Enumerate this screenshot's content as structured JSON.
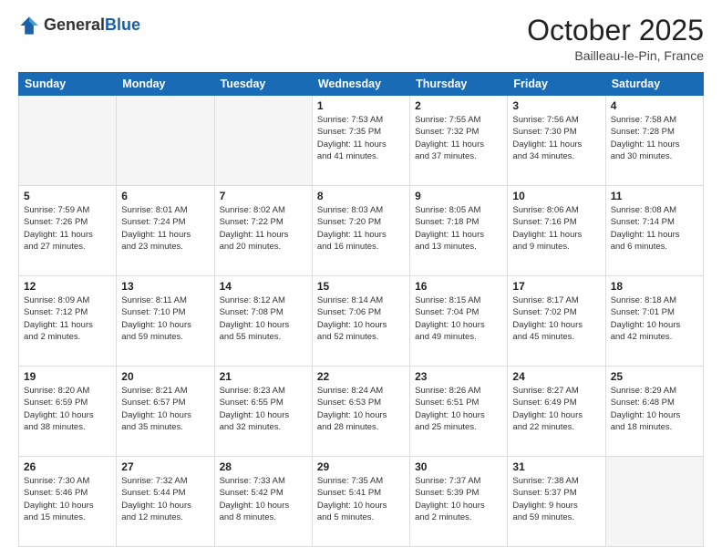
{
  "header": {
    "logo_general": "General",
    "logo_blue": "Blue",
    "month_title": "October 2025",
    "location": "Bailleau-le-Pin, France"
  },
  "days_of_week": [
    "Sunday",
    "Monday",
    "Tuesday",
    "Wednesday",
    "Thursday",
    "Friday",
    "Saturday"
  ],
  "weeks": [
    [
      {
        "day": "",
        "info": ""
      },
      {
        "day": "",
        "info": ""
      },
      {
        "day": "",
        "info": ""
      },
      {
        "day": "1",
        "info": "Sunrise: 7:53 AM\nSunset: 7:35 PM\nDaylight: 11 hours\nand 41 minutes."
      },
      {
        "day": "2",
        "info": "Sunrise: 7:55 AM\nSunset: 7:32 PM\nDaylight: 11 hours\nand 37 minutes."
      },
      {
        "day": "3",
        "info": "Sunrise: 7:56 AM\nSunset: 7:30 PM\nDaylight: 11 hours\nand 34 minutes."
      },
      {
        "day": "4",
        "info": "Sunrise: 7:58 AM\nSunset: 7:28 PM\nDaylight: 11 hours\nand 30 minutes."
      }
    ],
    [
      {
        "day": "5",
        "info": "Sunrise: 7:59 AM\nSunset: 7:26 PM\nDaylight: 11 hours\nand 27 minutes."
      },
      {
        "day": "6",
        "info": "Sunrise: 8:01 AM\nSunset: 7:24 PM\nDaylight: 11 hours\nand 23 minutes."
      },
      {
        "day": "7",
        "info": "Sunrise: 8:02 AM\nSunset: 7:22 PM\nDaylight: 11 hours\nand 20 minutes."
      },
      {
        "day": "8",
        "info": "Sunrise: 8:03 AM\nSunset: 7:20 PM\nDaylight: 11 hours\nand 16 minutes."
      },
      {
        "day": "9",
        "info": "Sunrise: 8:05 AM\nSunset: 7:18 PM\nDaylight: 11 hours\nand 13 minutes."
      },
      {
        "day": "10",
        "info": "Sunrise: 8:06 AM\nSunset: 7:16 PM\nDaylight: 11 hours\nand 9 minutes."
      },
      {
        "day": "11",
        "info": "Sunrise: 8:08 AM\nSunset: 7:14 PM\nDaylight: 11 hours\nand 6 minutes."
      }
    ],
    [
      {
        "day": "12",
        "info": "Sunrise: 8:09 AM\nSunset: 7:12 PM\nDaylight: 11 hours\nand 2 minutes."
      },
      {
        "day": "13",
        "info": "Sunrise: 8:11 AM\nSunset: 7:10 PM\nDaylight: 10 hours\nand 59 minutes."
      },
      {
        "day": "14",
        "info": "Sunrise: 8:12 AM\nSunset: 7:08 PM\nDaylight: 10 hours\nand 55 minutes."
      },
      {
        "day": "15",
        "info": "Sunrise: 8:14 AM\nSunset: 7:06 PM\nDaylight: 10 hours\nand 52 minutes."
      },
      {
        "day": "16",
        "info": "Sunrise: 8:15 AM\nSunset: 7:04 PM\nDaylight: 10 hours\nand 49 minutes."
      },
      {
        "day": "17",
        "info": "Sunrise: 8:17 AM\nSunset: 7:02 PM\nDaylight: 10 hours\nand 45 minutes."
      },
      {
        "day": "18",
        "info": "Sunrise: 8:18 AM\nSunset: 7:01 PM\nDaylight: 10 hours\nand 42 minutes."
      }
    ],
    [
      {
        "day": "19",
        "info": "Sunrise: 8:20 AM\nSunset: 6:59 PM\nDaylight: 10 hours\nand 38 minutes."
      },
      {
        "day": "20",
        "info": "Sunrise: 8:21 AM\nSunset: 6:57 PM\nDaylight: 10 hours\nand 35 minutes."
      },
      {
        "day": "21",
        "info": "Sunrise: 8:23 AM\nSunset: 6:55 PM\nDaylight: 10 hours\nand 32 minutes."
      },
      {
        "day": "22",
        "info": "Sunrise: 8:24 AM\nSunset: 6:53 PM\nDaylight: 10 hours\nand 28 minutes."
      },
      {
        "day": "23",
        "info": "Sunrise: 8:26 AM\nSunset: 6:51 PM\nDaylight: 10 hours\nand 25 minutes."
      },
      {
        "day": "24",
        "info": "Sunrise: 8:27 AM\nSunset: 6:49 PM\nDaylight: 10 hours\nand 22 minutes."
      },
      {
        "day": "25",
        "info": "Sunrise: 8:29 AM\nSunset: 6:48 PM\nDaylight: 10 hours\nand 18 minutes."
      }
    ],
    [
      {
        "day": "26",
        "info": "Sunrise: 7:30 AM\nSunset: 5:46 PM\nDaylight: 10 hours\nand 15 minutes."
      },
      {
        "day": "27",
        "info": "Sunrise: 7:32 AM\nSunset: 5:44 PM\nDaylight: 10 hours\nand 12 minutes."
      },
      {
        "day": "28",
        "info": "Sunrise: 7:33 AM\nSunset: 5:42 PM\nDaylight: 10 hours\nand 8 minutes."
      },
      {
        "day": "29",
        "info": "Sunrise: 7:35 AM\nSunset: 5:41 PM\nDaylight: 10 hours\nand 5 minutes."
      },
      {
        "day": "30",
        "info": "Sunrise: 7:37 AM\nSunset: 5:39 PM\nDaylight: 10 hours\nand 2 minutes."
      },
      {
        "day": "31",
        "info": "Sunrise: 7:38 AM\nSunset: 5:37 PM\nDaylight: 9 hours\nand 59 minutes."
      },
      {
        "day": "",
        "info": ""
      }
    ]
  ]
}
